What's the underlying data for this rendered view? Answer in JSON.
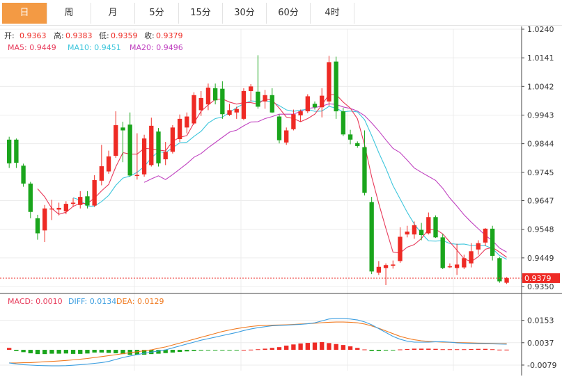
{
  "tabs": [
    {
      "label": "日",
      "active": true
    },
    {
      "label": "周",
      "active": false
    },
    {
      "label": "月",
      "active": false
    },
    {
      "label": "5分",
      "active": false
    },
    {
      "label": "15分",
      "active": false
    },
    {
      "label": "30分",
      "active": false
    },
    {
      "label": "60分",
      "active": false
    },
    {
      "label": "4时",
      "active": false
    }
  ],
  "info": {
    "open_label": "开:",
    "open_value": "0.9363",
    "high_label": "高:",
    "high_value": "0.9383",
    "low_label": "低:",
    "low_value": "0.9359",
    "close_label": "收:",
    "close_value": "0.9379",
    "ma5": "MA5: 0.9449",
    "ma10": "MA10: 0.9451",
    "ma20": "MA20: 0.9496",
    "macd": "MACD: 0.0010",
    "diff": "DIFF: 0.0134",
    "dea": "DEA: 0.0129"
  },
  "colors": {
    "up": "#ee2a24",
    "down": "#1aa51c",
    "ma5": "#e83a5a",
    "ma10": "#3ec6dc",
    "ma20": "#c042c0",
    "diff": "#3c9ee0",
    "dea": "#f07a20",
    "tab_active": "#f39a44"
  },
  "chart_data": [
    {
      "type": "candlestick",
      "y_ticks": [
        "1.0240",
        "1.0141",
        "1.0042",
        "0.9943",
        "0.9844",
        "0.9745",
        "0.9647",
        "0.9548",
        "0.9449",
        "0.9350"
      ],
      "ylim": [
        0.935,
        1.024
      ],
      "current_price": "0.9379",
      "candles": [
        [
          0.9858,
          0.9776,
          0.9868,
          0.976
        ],
        [
          0.9858,
          0.9778,
          0.9862,
          0.976
        ],
        [
          0.9768,
          0.9706,
          0.9775,
          0.9695
        ],
        [
          0.9706,
          0.9608,
          0.9712,
          0.9586
        ],
        [
          0.9586,
          0.9534,
          0.9598,
          0.9512
        ],
        [
          0.9544,
          0.962,
          0.9632,
          0.9504
        ],
        [
          0.9618,
          0.962,
          0.965,
          0.958
        ],
        [
          0.9616,
          0.9622,
          0.964,
          0.9596
        ],
        [
          0.961,
          0.9636,
          0.9645,
          0.96
        ],
        [
          0.9636,
          0.964,
          0.9656,
          0.9625
        ],
        [
          0.9632,
          0.966,
          0.968,
          0.962
        ],
        [
          0.9662,
          0.963,
          0.968,
          0.962
        ],
        [
          0.963,
          0.9718,
          0.9735,
          0.9625
        ],
        [
          0.9716,
          0.9766,
          0.984,
          0.97
        ],
        [
          0.9748,
          0.98,
          0.982,
          0.974
        ],
        [
          0.9802,
          0.9908,
          0.9956,
          0.9795
        ],
        [
          0.99,
          0.989,
          0.992,
          0.978
        ],
        [
          0.991,
          0.9734,
          0.9952,
          0.973
        ],
        [
          0.9736,
          0.9736,
          0.988,
          0.972
        ],
        [
          0.9738,
          0.9862,
          0.9875,
          0.973
        ],
        [
          0.977,
          0.9906,
          0.9934,
          0.9765
        ],
        [
          0.9886,
          0.9776,
          0.9898,
          0.9765
        ],
        [
          0.979,
          0.9816,
          0.985,
          0.977
        ],
        [
          0.9816,
          0.99,
          0.9908,
          0.981
        ],
        [
          0.986,
          0.993,
          0.9945,
          0.985
        ],
        [
          0.99,
          0.9938,
          0.9952,
          0.988
        ],
        [
          0.9914,
          1.0012,
          1.0022,
          0.991
        ],
        [
          0.996,
          1.0002,
          1.0026,
          0.994
        ],
        [
          0.998,
          1.0038,
          1.0052,
          0.996
        ],
        [
          1.0036,
          0.9994,
          1.0052,
          0.998
        ],
        [
          1.0034,
          0.9946,
          1.006,
          0.993
        ],
        [
          0.9944,
          0.996,
          0.9982,
          0.994
        ],
        [
          0.9952,
          0.9964,
          0.9972,
          0.993
        ],
        [
          0.993,
          1.0026,
          1.0036,
          0.9925
        ],
        [
          1.0026,
          1.0042,
          1.005,
          0.999
        ],
        [
          1.0024,
          0.9972,
          1.015,
          0.9965
        ],
        [
          0.999,
          1.0012,
          1.003,
          0.9965
        ],
        [
          1.0012,
          0.9952,
          1.0036,
          0.995
        ],
        [
          0.9938,
          0.9856,
          0.9945,
          0.9845
        ],
        [
          0.9848,
          0.989,
          0.99,
          0.984
        ],
        [
          0.9894,
          0.9946,
          0.9962,
          0.989
        ],
        [
          0.9942,
          0.9956,
          0.9962,
          0.992
        ],
        [
          0.9956,
          1.0008,
          1.0015,
          0.995
        ],
        [
          0.9982,
          0.997,
          0.999,
          0.9962
        ],
        [
          0.997,
          1.001,
          1.0036,
          0.9935
        ],
        [
          0.999,
          1.0126,
          1.0148,
          0.9975
        ],
        [
          1.0128,
          0.9956,
          1.0145,
          0.993
        ],
        [
          0.9956,
          0.9876,
          0.9968,
          0.987
        ],
        [
          0.9876,
          0.9858,
          0.9892,
          0.9842
        ],
        [
          0.9846,
          0.9836,
          0.9852,
          0.983
        ],
        [
          0.9832,
          0.9674,
          0.989,
          0.9665
        ],
        [
          0.9642,
          0.9402,
          0.966,
          0.9393
        ],
        [
          0.9398,
          0.9418,
          0.9438,
          0.939
        ],
        [
          0.9414,
          0.9424,
          0.943,
          0.9355
        ],
        [
          0.9422,
          0.9426,
          0.944,
          0.9412
        ],
        [
          0.9438,
          0.9522,
          0.9555,
          0.9432
        ],
        [
          0.953,
          0.954,
          0.956,
          0.952
        ],
        [
          0.953,
          0.9562,
          0.9575,
          0.9515
        ],
        [
          0.9546,
          0.9528,
          0.957,
          0.951
        ],
        [
          0.9534,
          0.959,
          0.9606,
          0.953
        ],
        [
          0.959,
          0.952,
          0.9596,
          0.9518
        ],
        [
          0.952,
          0.9414,
          0.9532,
          0.941
        ],
        [
          0.9418,
          0.942,
          0.943,
          0.9414
        ],
        [
          0.9414,
          0.9426,
          0.9498,
          0.939
        ],
        [
          0.9416,
          0.9448,
          0.946,
          0.941
        ],
        [
          0.943,
          0.9472,
          0.95,
          0.9416
        ],
        [
          0.9478,
          0.95,
          0.951,
          0.946
        ],
        [
          0.9502,
          0.955,
          0.9552,
          0.949
        ],
        [
          0.955,
          0.9456,
          0.956,
          0.944
        ],
        [
          0.9448,
          0.9368,
          0.9452,
          0.9363
        ],
        [
          0.9363,
          0.9379,
          0.9383,
          0.9359
        ]
      ],
      "ma5": [
        null,
        null,
        null,
        null,
        0.9688,
        0.966,
        0.962,
        0.96,
        0.9607,
        0.9627,
        0.9638,
        0.9637,
        0.9656,
        0.9681,
        0.9703,
        0.9764,
        0.9813,
        0.9808,
        0.9808,
        0.9828,
        0.9826,
        0.9822,
        0.9819,
        0.9852,
        0.9866,
        0.9872,
        0.9916,
        0.9956,
        0.9978,
        0.9997,
        0.9999,
        0.9988,
        0.9981,
        0.9986,
        0.9986,
        0.9981,
        0.9999,
        0.9995,
        0.9967,
        0.9936,
        0.9931,
        0.992,
        0.9931,
        0.9946,
        0.9978,
        1.0014,
        1.0014,
        0.9988,
        0.9967,
        0.993,
        0.984,
        0.9729,
        0.9637,
        0.9551,
        0.9469,
        0.9466,
        0.9486,
        0.9495,
        0.9516,
        0.9548,
        0.9548,
        0.9532,
        0.9504,
        0.9476,
        0.9446,
        0.9436,
        0.9453,
        0.9479,
        0.9485,
        0.9469,
        0.9451
      ],
      "ma10": [
        null,
        null,
        null,
        null,
        null,
        null,
        null,
        null,
        null,
        0.9657,
        0.9649,
        0.9628,
        0.9628,
        0.9644,
        0.9665,
        0.97,
        0.9725,
        0.9732,
        0.9745,
        0.9765,
        0.9795,
        0.9817,
        0.9813,
        0.983,
        0.9847,
        0.9849,
        0.9869,
        0.9887,
        0.9915,
        0.9931,
        0.9936,
        0.9952,
        0.9969,
        0.9982,
        0.9992,
        0.999,
        0.9993,
        0.9988,
        0.9976,
        0.9961,
        0.9956,
        0.996,
        0.9963,
        0.9956,
        0.9957,
        0.9973,
        0.9967,
        0.9954,
        0.9957,
        0.9954,
        0.9927,
        0.9872,
        0.9813,
        0.9759,
        0.9699,
        0.9653,
        0.9607,
        0.9566,
        0.9534,
        0.9508,
        0.9507,
        0.9509,
        0.9499,
        0.9496,
        0.9497,
        0.9492,
        0.9492,
        0.9491,
        0.9481,
        0.9457,
        0.9444
      ],
      "ma20": [
        null,
        null,
        null,
        null,
        null,
        null,
        null,
        null,
        null,
        null,
        null,
        null,
        null,
        null,
        null,
        null,
        null,
        null,
        null,
        0.971,
        0.9722,
        0.9733,
        0.972,
        0.9737,
        0.9756,
        0.9775,
        0.9797,
        0.981,
        0.983,
        0.9848,
        0.9866,
        0.9884,
        0.9891,
        0.9906,
        0.9919,
        0.992,
        0.9931,
        0.9938,
        0.9946,
        0.9946,
        0.9946,
        0.9956,
        0.9966,
        0.9969,
        0.9974,
        0.9982,
        0.998,
        0.9971,
        0.9966,
        0.9957,
        0.9941,
        0.9916,
        0.9888,
        0.9857,
        0.9828,
        0.9813,
        0.9787,
        0.976,
        0.9745,
        0.9731,
        0.9717,
        0.969,
        0.9656,
        0.9628,
        0.9598,
        0.9573,
        0.955,
        0.9527,
        0.9508,
        0.9483,
        0.9469
      ]
    },
    {
      "type": "macd",
      "y_ticks": [
        "0.0153",
        "0.0037",
        "-0.0079"
      ],
      "ylim": [
        -0.0108,
        0.0195
      ],
      "macd": [
        0.001,
        -0.0006,
        -0.0012,
        -0.0018,
        -0.0022,
        -0.0022,
        -0.002,
        -0.002,
        -0.0019,
        -0.0021,
        -0.0021,
        -0.0019,
        -0.0014,
        -0.0014,
        -0.0016,
        -0.0018,
        -0.0022,
        -0.0026,
        -0.0026,
        -0.0025,
        -0.0022,
        -0.002,
        -0.0017,
        -0.0014,
        -0.0011,
        -0.0008,
        -0.0006,
        -0.0004,
        -0.0003,
        -0.0002,
        -0.0001,
        -0.0001,
        -0.0001,
        0.0,
        0.0001,
        0.0003,
        0.0006,
        0.001,
        0.0014,
        0.0022,
        0.0028,
        0.0033,
        0.0036,
        0.0038,
        0.004,
        0.0035,
        0.003,
        0.0025,
        0.0018,
        0.001,
        0.0002,
        -0.0006,
        -0.0006,
        -0.0004,
        -0.0003,
        0.0002,
        0.0004,
        0.0006,
        0.0006,
        0.0006,
        0.0005,
        0.0003,
        0.0003,
        0.0003,
        0.0003,
        0.0004,
        0.0005,
        0.0005,
        0.0003,
        0.0001,
        0.0001
      ],
      "diff": [
        -0.0068,
        -0.0073,
        -0.0077,
        -0.0079,
        -0.0081,
        -0.0082,
        -0.0083,
        -0.0083,
        -0.0082,
        -0.008,
        -0.0077,
        -0.0074,
        -0.007,
        -0.0066,
        -0.006,
        -0.005,
        -0.004,
        -0.0032,
        -0.0025,
        -0.0018,
        -0.0012,
        -0.0006,
        0.0,
        0.001,
        0.002,
        0.003,
        0.004,
        0.005,
        0.0058,
        0.0066,
        0.0074,
        0.0082,
        0.009,
        0.01,
        0.0108,
        0.0115,
        0.012,
        0.0125,
        0.0127,
        0.0128,
        0.013,
        0.0132,
        0.0135,
        0.014,
        0.015,
        0.016,
        0.0162,
        0.0162,
        0.016,
        0.0155,
        0.0145,
        0.013,
        0.011,
        0.009,
        0.007,
        0.0055,
        0.0045,
        0.004,
        0.004,
        0.004,
        0.0042,
        0.0042,
        0.004,
        0.0036,
        0.0034,
        0.0033,
        0.0032,
        0.0032,
        0.0031,
        0.003,
        0.0029
      ],
      "dea": [
        -0.0068,
        -0.0068,
        -0.0067,
        -0.0066,
        -0.0064,
        -0.0062,
        -0.006,
        -0.0058,
        -0.0055,
        -0.0052,
        -0.0049,
        -0.0045,
        -0.004,
        -0.0035,
        -0.003,
        -0.0025,
        -0.002,
        -0.0015,
        -0.001,
        -0.0005,
        0.0,
        0.0008,
        0.0015,
        0.0025,
        0.0035,
        0.0045,
        0.0055,
        0.0065,
        0.0075,
        0.0085,
        0.0095,
        0.0103,
        0.011,
        0.0116,
        0.0121,
        0.0125,
        0.0127,
        0.0128,
        0.0129,
        0.013,
        0.0132,
        0.0134,
        0.0136,
        0.0138,
        0.0141,
        0.0143,
        0.0144,
        0.0144,
        0.0143,
        0.014,
        0.0134,
        0.0124,
        0.0112,
        0.0098,
        0.0084,
        0.007,
        0.006,
        0.0052,
        0.0047,
        0.0044,
        0.0042,
        0.004,
        0.0039,
        0.0038,
        0.0037,
        0.0036,
        0.0035,
        0.0034,
        0.0033,
        0.0032,
        0.0032
      ]
    }
  ]
}
